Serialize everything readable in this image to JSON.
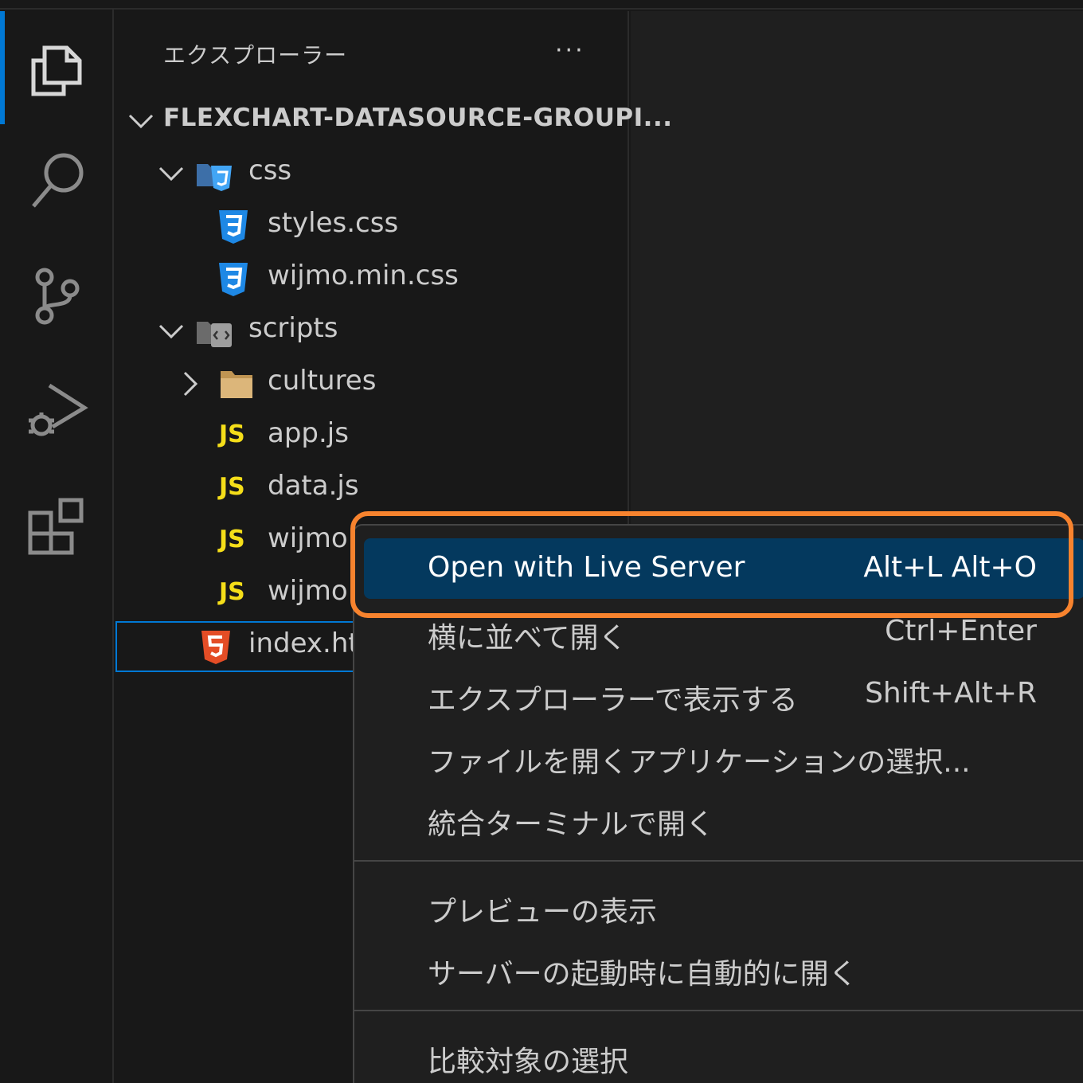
{
  "activity_bar": {
    "icons": [
      "files-icon",
      "search-icon",
      "source-control-icon",
      "run-debug-icon",
      "extensions-icon"
    ]
  },
  "sidebar": {
    "title": "エクスプローラー",
    "more": "···",
    "root": "FLEXCHART-DATASOURCE-GROUPI...",
    "tree": {
      "css_folder": "css",
      "styles_css": "styles.css",
      "wijmo_min_css": "wijmo.min.css",
      "scripts_folder": "scripts",
      "cultures_folder": "cultures",
      "app_js": "app.js",
      "data_js": "data.js",
      "wijmo_1": "wijmo",
      "wijmo_2": "wijmo",
      "index_html": "index.ht",
      "js_badge": "JS"
    }
  },
  "context_menu": {
    "items": [
      {
        "label": "Open with Live Server",
        "shortcut": "Alt+L Alt+O"
      },
      {
        "label": "横に並べて開く",
        "shortcut": "Ctrl+Enter"
      },
      {
        "label": "エクスプローラーで表示する",
        "shortcut": "Shift+Alt+R"
      },
      {
        "label": "ファイルを開くアプリケーションの選択...",
        "shortcut": ""
      },
      {
        "label": "統合ターミナルで開く",
        "shortcut": ""
      },
      {
        "label": "プレビューの表示",
        "shortcut": ""
      },
      {
        "label": "サーバーの起動時に自動的に開く",
        "shortcut": ""
      },
      {
        "label": "比較対象の選択",
        "shortcut": ""
      }
    ]
  },
  "colors": {
    "accent": "#0078d4",
    "highlight_outline": "#f7832e",
    "menu_active": "#04395e",
    "js_yellow": "#f5de19",
    "css_blue": "#1e88e5",
    "html_orange": "#e44d26"
  }
}
